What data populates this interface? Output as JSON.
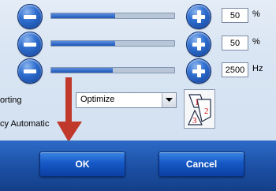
{
  "sliders": [
    {
      "value": "50",
      "unit": "%",
      "fill_fraction": 0.52
    },
    {
      "value": "50",
      "unit": "%",
      "fill_fraction": 0.52
    },
    {
      "value": "2500",
      "unit": "Hz",
      "fill_fraction": 0.5
    }
  ],
  "controls": {
    "sorting_label": "orting",
    "mode_value": "Optimize",
    "auto_label": "cy Automatic"
  },
  "buttons": {
    "ok_label": "OK",
    "cancel_label": "Cancel"
  },
  "icons": {
    "decrease": "minus-icon",
    "increase": "plus-icon",
    "dropdown": "chevron-down-icon",
    "ordering": "numbered-order-icon",
    "annotation": "red-arrow-annotation"
  },
  "colors": {
    "accent_blue": "#1659c6",
    "panel_bg": "#d9e5f3",
    "annotation_red": "#c0392b",
    "icon_numbers": "#cc0000"
  }
}
